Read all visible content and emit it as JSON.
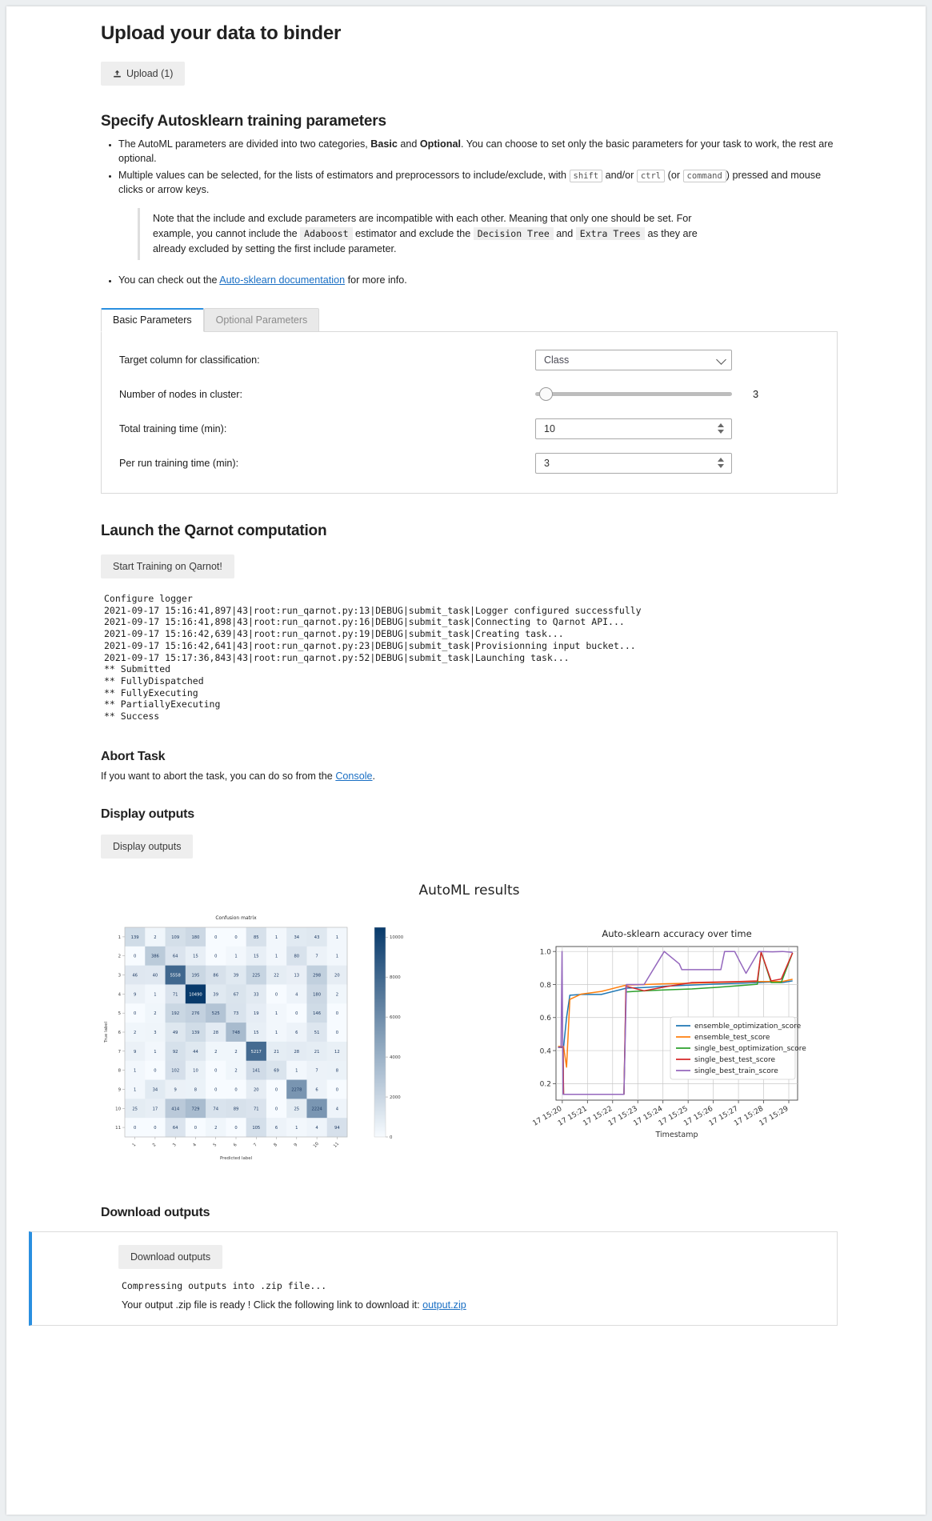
{
  "upload": {
    "heading": "Upload your data to binder",
    "button_label": "Upload (1)",
    "button_icon": "upload-icon"
  },
  "params": {
    "heading": "Specify Autosklearn training parameters",
    "bullet1_a": "The AutoML parameters are divided into two categories, ",
    "bullet1_basic": "Basic",
    "bullet1_b": " and ",
    "bullet1_optional": "Optional",
    "bullet1_c": ". You can choose to set only the basic parameters for your task to work, the rest are optional.",
    "bullet2_a": "Multiple values can be selected, for the lists of estimators and preprocessors to include/exclude, with ",
    "key_shift": "shift",
    "bullet2_b": " and/or ",
    "key_ctrl": "ctrl",
    "bullet2_c": " (or ",
    "key_command": "command",
    "bullet2_d": ") pressed and mouse clicks or arrow keys.",
    "note_a": "Note that the include and exclude parameters are incompatible with each other. Meaning that only one should be set. For example, you cannot include the ",
    "note_adaboost": "Adaboost",
    "note_b": " estimator and exclude the ",
    "note_decision_tree": "Decision Tree",
    "note_c": " and ",
    "note_extra_trees": "Extra Trees",
    "note_d": " as they are already excluded by setting the first include parameter.",
    "bullet3_a": "You can check out the ",
    "doc_link": "Auto-sklearn documentation",
    "bullet3_b": " for more info.",
    "tabs": [
      {
        "label": "Basic Parameters",
        "active": true
      },
      {
        "label": "Optional Parameters",
        "active": false
      }
    ],
    "rows": [
      {
        "label": "Target column for classification:",
        "type": "select",
        "value": "Class"
      },
      {
        "label": "Number of nodes in cluster:",
        "type": "slider",
        "value": "3"
      },
      {
        "label": "Total training time (min):",
        "type": "number",
        "value": "10"
      },
      {
        "label": "Per run training time (min):",
        "type": "number",
        "value": "3"
      }
    ]
  },
  "launch": {
    "heading": "Launch the Qarnot computation",
    "button_label": "Start Training on Qarnot!",
    "log": "Configure logger\n2021-09-17 15:16:41,897|43|root:run_qarnot.py:13|DEBUG|submit_task|Logger configured successfully\n2021-09-17 15:16:41,898|43|root:run_qarnot.py:16|DEBUG|submit_task|Connecting to Qarnot API...\n2021-09-17 15:16:42,639|43|root:run_qarnot.py:19|DEBUG|submit_task|Creating task...\n2021-09-17 15:16:42,641|43|root:run_qarnot.py:23|DEBUG|submit_task|Provisionning input bucket...\n2021-09-17 15:17:36,843|43|root:run_qarnot.py:52|DEBUG|submit_task|Launching task...\n** Submitted\n** FullyDispatched\n** FullyExecuting\n** PartiallyExecuting\n** Success"
  },
  "abort": {
    "heading": "Abort Task",
    "text_a": "If you want to abort the task, you can do so from the ",
    "link": "Console",
    "text_b": "."
  },
  "display": {
    "heading": "Display outputs",
    "button_label": "Display outputs",
    "results_title": "AutoML results"
  },
  "download": {
    "heading": "Download outputs",
    "button_label": "Download outputs",
    "log": "Compressing outputs into .zip file...",
    "ready_a": "Your output .zip file is ready ! Click the following link to download it: ",
    "link": "output.zip"
  },
  "chart_data": [
    {
      "type": "heatmap",
      "title": "Confusion matrix",
      "xlabel": "Predicted label",
      "ylabel": "True label",
      "x_tick_labels": [
        "1",
        "2",
        "3",
        "4",
        "5",
        "6",
        "7",
        "8",
        "9",
        "10",
        "11"
      ],
      "y_tick_labels": [
        "1",
        "2",
        "3",
        "4",
        "5",
        "6",
        "7",
        "8",
        "9",
        "10",
        "11"
      ],
      "colorbar": {
        "ticks": [
          0,
          2000,
          4000,
          6000,
          8000,
          10000
        ],
        "tick_labels": [
          "0",
          "2000",
          "4000",
          "6000",
          "8000",
          "10000"
        ],
        "vmin": 0,
        "vmax": 10490,
        "colormap": "Blues"
      },
      "values": [
        [
          139,
          2,
          109,
          180,
          0,
          0,
          85,
          1,
          34,
          43,
          1
        ],
        [
          0,
          386,
          64,
          15,
          0,
          1,
          15,
          1,
          80,
          7,
          1
        ],
        [
          46,
          40,
          5558,
          195,
          86,
          39,
          225,
          22,
          13,
          298,
          20
        ],
        [
          9,
          1,
          71,
          10490,
          39,
          67,
          33,
          0,
          4,
          180,
          2
        ],
        [
          0,
          2,
          192,
          276,
          525,
          73,
          19,
          1,
          0,
          146,
          0
        ],
        [
          2,
          3,
          49,
          139,
          28,
          748,
          15,
          1,
          6,
          51,
          0
        ],
        [
          9,
          1,
          92,
          44,
          2,
          2,
          5217,
          21,
          28,
          21,
          12
        ],
        [
          1,
          0,
          102,
          10,
          0,
          2,
          141,
          69,
          1,
          7,
          8
        ],
        [
          1,
          34,
          9,
          8,
          0,
          0,
          20,
          0,
          2278,
          6,
          0
        ],
        [
          25,
          17,
          414,
          729,
          74,
          89,
          71,
          0,
          25,
          2224,
          4
        ],
        [
          0,
          0,
          64,
          0,
          2,
          0,
          105,
          6,
          1,
          4,
          94
        ]
      ]
    },
    {
      "type": "line",
      "title": "Auto-sklearn accuracy over time",
      "xlabel": "Timestamp",
      "ylabel": "",
      "x_tick_labels": [
        "17 15:20",
        "17 15:21",
        "17 15:22",
        "17 15:23",
        "17 15:24",
        "17 15:25",
        "17 15:26",
        "17 15:27",
        "17 15:28",
        "17 15:29"
      ],
      "y_tick_labels": [
        "0.2",
        "0.4",
        "0.6",
        "0.8",
        "1.0"
      ],
      "ylim": [
        0.1,
        1.03
      ],
      "grid": true,
      "legend_position": "lower right",
      "series": [
        {
          "name": "ensemble_optimization_score",
          "color": "#1f77b4",
          "x": [
            0.08,
            0.3,
            0.42,
            0.55,
            1.0,
            1.8,
            2.8,
            3.5,
            4.4,
            5.4,
            6.4,
            7.3,
            8.1,
            8.5,
            9.0,
            9.4
          ],
          "y": [
            0.42,
            0.42,
            0.6,
            0.735,
            0.74,
            0.74,
            0.778,
            0.782,
            0.79,
            0.797,
            0.803,
            0.808,
            0.812,
            0.815,
            0.812,
            0.822
          ]
        },
        {
          "name": "ensemble_test_score",
          "color": "#ff7f0e",
          "x": [
            0.08,
            0.3,
            0.42,
            0.55,
            1.0,
            1.8,
            2.8,
            3.5,
            4.4,
            5.4,
            6.4,
            7.3,
            8.1,
            8.5,
            9.0,
            9.4
          ],
          "y": [
            0.425,
            0.425,
            0.3,
            0.71,
            0.742,
            0.758,
            0.797,
            0.8,
            0.805,
            0.808,
            0.812,
            0.816,
            0.818,
            0.818,
            0.818,
            0.832
          ]
        },
        {
          "name": "single_best_optimization_score",
          "color": "#2ca02c",
          "x": [
            0.08,
            0.28,
            0.3,
            0.34,
            2.7,
            2.78,
            3.5,
            4.4,
            5.4,
            6.4,
            7.3,
            8.0,
            8.15,
            8.55,
            8.95,
            9.4
          ],
          "y": [
            0.42,
            0.42,
            0.135,
            0.135,
            0.135,
            0.755,
            0.762,
            0.768,
            0.773,
            0.783,
            0.793,
            0.802,
            0.997,
            0.812,
            0.812,
            0.992
          ]
        },
        {
          "name": "single_best_test_score",
          "color": "#d62728",
          "x": [
            0.08,
            0.28,
            0.3,
            0.34,
            2.7,
            2.78,
            3.5,
            4.4,
            5.4,
            6.4,
            7.3,
            8.0,
            8.15,
            8.55,
            8.95,
            9.4
          ],
          "y": [
            0.42,
            0.42,
            0.135,
            0.135,
            0.135,
            0.79,
            0.762,
            0.788,
            0.812,
            0.815,
            0.818,
            0.822,
            0.997,
            0.822,
            0.833,
            0.992
          ]
        },
        {
          "name": "single_best_train_score",
          "color": "#9467bd",
          "x": [
            0.08,
            0.2,
            0.24,
            0.28,
            0.32,
            2.7,
            2.8,
            3.5,
            4.3,
            4.9,
            5.0,
            6.55,
            6.7,
            7.1,
            7.3,
            7.55,
            8.05,
            8.6,
            9.0,
            9.4
          ],
          "y": [
            0.42,
            0.42,
            1.0,
            0.135,
            0.135,
            0.135,
            0.8,
            0.8,
            1.0,
            0.925,
            0.89,
            0.89,
            1.0,
            1.0,
            0.94,
            0.868,
            1.0,
            0.998,
            1.0,
            0.995
          ]
        }
      ]
    }
  ]
}
